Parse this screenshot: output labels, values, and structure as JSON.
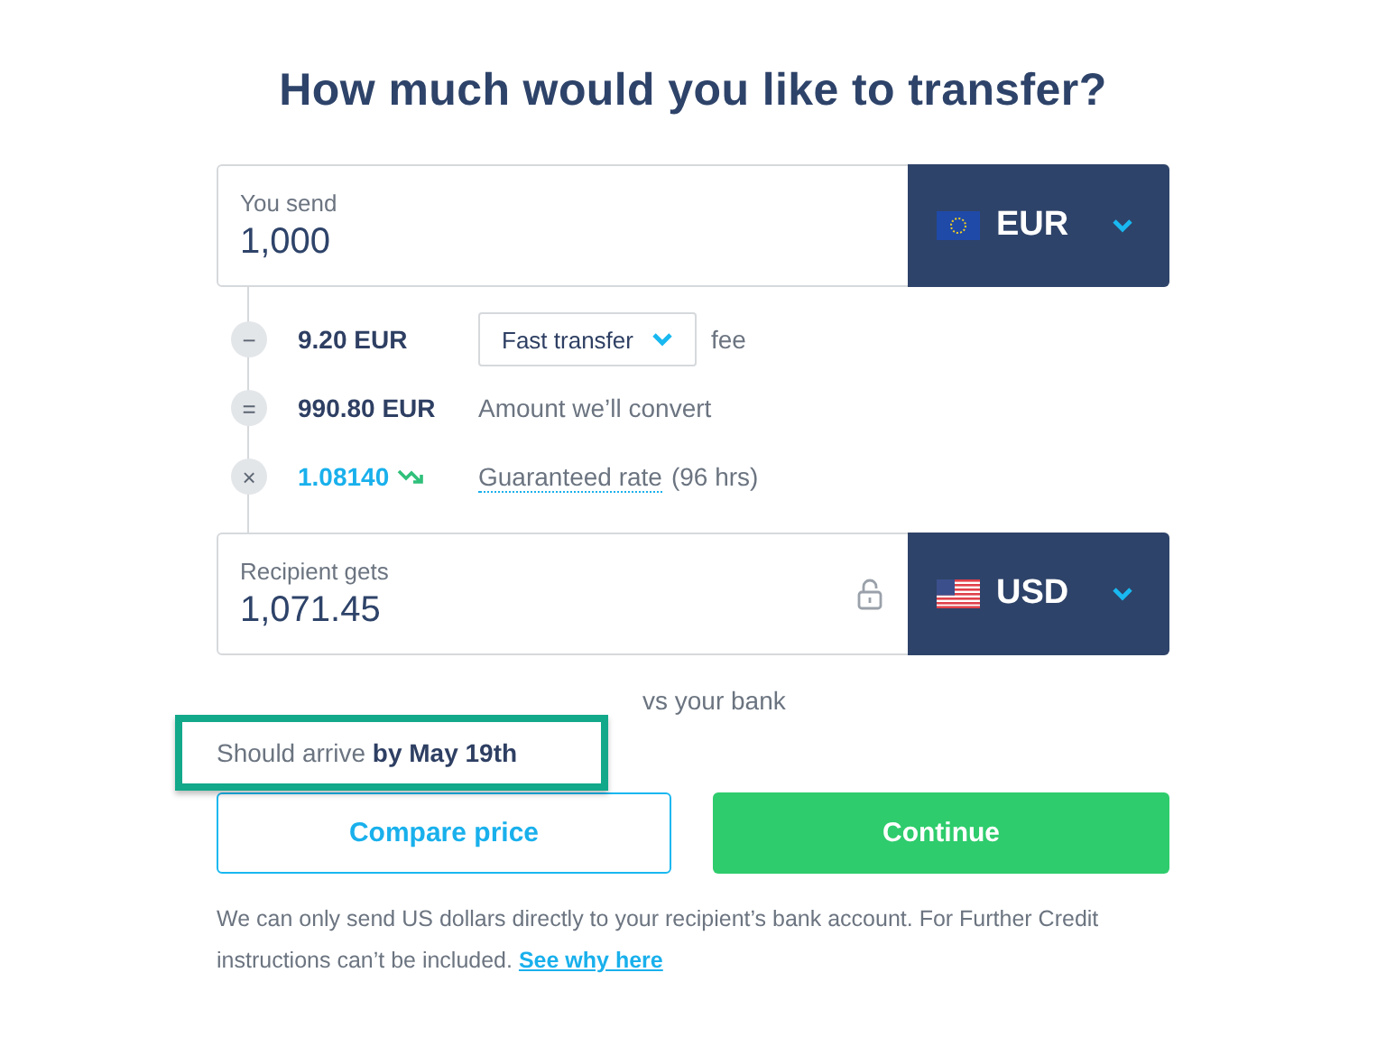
{
  "title": "How much would you like to transfer?",
  "send": {
    "label": "You send",
    "value": "1,000",
    "currency": "EUR",
    "kind": "eu"
  },
  "breakdown": [
    {
      "kind": "fee",
      "symbol": "−",
      "amount": "9.20 EUR",
      "option": "Fast transfer",
      "text": "fee"
    },
    {
      "kind": "convert",
      "symbol": "=",
      "amount": "990.80 EUR",
      "text": "Amount we’ll convert"
    },
    {
      "kind": "rate",
      "symbol": "×",
      "amount": "1.08140",
      "link": "Guaranteed rate",
      "text": "(96 hrs)"
    }
  ],
  "receive": {
    "label": "Recipient gets",
    "value": "1,071.45",
    "currency": "USD",
    "kind": "us",
    "locked": false
  },
  "savings_note": "vs your bank",
  "arrival": "Should arrive **by May 19th**",
  "buttons": [
    {
      "kind": "secondary",
      "label": "Compare price"
    },
    {
      "kind": "primary",
      "label": "Continue"
    }
  ],
  "footer": {
    "text": "We can only send US dollars directly to your recipient’s bank account. For Further Credit instructions can’t be included.",
    "link": "See why here"
  }
}
